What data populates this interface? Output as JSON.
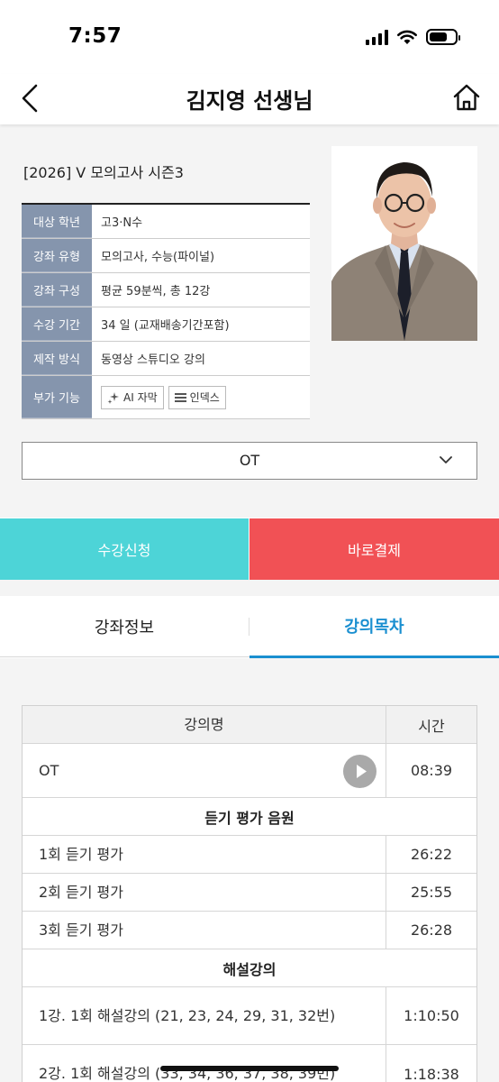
{
  "status_bar": {
    "time": "7:57"
  },
  "header": {
    "title": "김지영 선생님"
  },
  "course": {
    "title": "[2026] V 모의고사 시즌3",
    "info": [
      {
        "label": "대상 학년",
        "value": "고3·N수"
      },
      {
        "label": "강좌 유형",
        "value": "모의고사, 수능(파이널)"
      },
      {
        "label": "강좌 구성",
        "value": "평균 59분씩, 총 12강"
      },
      {
        "label": "수강 기간",
        "value": "34 일 (교재배송기간포함)"
      },
      {
        "label": "제작 방식",
        "value": "동영상 스튜디오 강의"
      }
    ],
    "features_label": "부가 기능",
    "features": [
      "AI 자막",
      "인덱스"
    ],
    "selected_lecture": "OT"
  },
  "actions": {
    "enroll": "수강신청",
    "pay_now": "바로결제"
  },
  "tabs": {
    "info": "강좌정보",
    "toc": "강의목차"
  },
  "lecture_table": {
    "headers": {
      "name": "강의명",
      "time": "시간"
    },
    "ot": {
      "name": "OT",
      "time": "08:39"
    },
    "section1": "듣기 평가 음원",
    "listening": [
      {
        "name": "1회 듣기 평가",
        "time": "26:22"
      },
      {
        "name": "2회 듣기 평가",
        "time": "25:55"
      },
      {
        "name": "3회 듣기 평가",
        "time": "26:28"
      }
    ],
    "section2": "해설강의",
    "lectures": [
      {
        "name": "1강. 1회 해설강의 (21, 23, 24, 29, 31, 32번)",
        "time": "1:10:50"
      },
      {
        "name": "2강. 1회 해설강의 (33, 34, 36, 37, 38, 39번)",
        "time": "1:18:38"
      }
    ]
  },
  "colors": {
    "enroll": "#4dd4d7",
    "pay": "#f15155",
    "accent": "#1a8fd0",
    "label_bg": "#8595ad"
  }
}
